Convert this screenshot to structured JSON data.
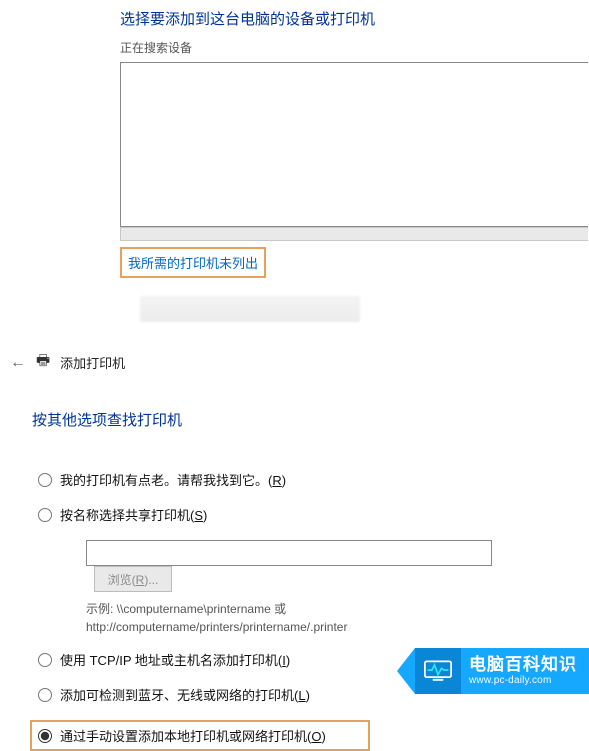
{
  "top": {
    "heading": "选择要添加到这台电脑的设备或打印机",
    "searching": "正在搜索设备",
    "not_listed": "我所需的打印机未列出"
  },
  "second": {
    "back_aria": "返回",
    "title": "添加打印机",
    "subheading": "按其他选项查找打印机"
  },
  "options": {
    "old": {
      "label": "我的打印机有点老。请帮我找到它。(",
      "shortcut": "R",
      "tail": ")"
    },
    "byname": {
      "label": "按名称选择共享打印机(",
      "shortcut": "S",
      "tail": ")"
    },
    "browse": {
      "label": "浏览(",
      "shortcut": "R",
      "tail": ")..."
    },
    "example_l1": "示例: \\\\computername\\printername 或",
    "example_l2": "http://computername/printers/printername/.printer",
    "tcpip": {
      "label": "使用 TCP/IP 地址或主机名添加打印机(",
      "shortcut": "I",
      "tail": ")"
    },
    "wireless": {
      "label": "添加可检测到蓝牙、无线或网络的打印机(",
      "shortcut": "L",
      "tail": ")"
    },
    "manual": {
      "label": "通过手动设置添加本地打印机或网络打印机(",
      "shortcut": "O",
      "tail": ")"
    },
    "share_value": ""
  },
  "watermark": {
    "cn": "电脑百科知识",
    "en": "www.pc-daily.com"
  }
}
